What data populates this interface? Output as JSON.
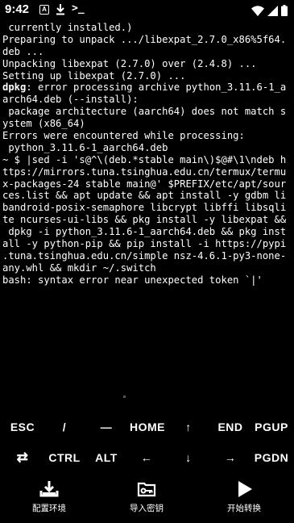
{
  "status_bar": {
    "time": "9:42",
    "notification_a": "A",
    "terminal_glyph": ">_"
  },
  "terminal": {
    "lines": [
      " currently installed.)",
      "Preparing to unpack .../libexpat_2.7.0_x86%5f64.",
      "deb ...",
      "Unpacking libexpat (2.7.0) over (2.4.8) ...",
      "Setting up libexpat (2.7.0) ...",
      "__DPKG__: error processing archive python_3.11.6-1_a",
      "arch64.deb (--install):",
      " package architecture (aarch64) does not match s",
      "ystem (x86_64)",
      "Errors were encountered while processing:",
      " python_3.11.6-1_aarch64.deb",
      "~ $ |sed -i 's@^\\(deb.*stable main\\)$@#\\1\\ndeb h",
      "ttps://mirrors.tuna.tsinghua.edu.cn/termux/termu",
      "x-packages-24 stable main@' $PREFIX/etc/apt/sour",
      "ces.list && apt update && apt install -y gdbm li",
      "bandroid-posix-semaphore libcrypt libffi libsqli",
      "te ncurses-ui-libs && pkg install -y libexpat &&",
      " dpkg -i python_3.11.6-1_aarch64.deb && pkg inst",
      "all -y python-pip && pip install -i https://pypi",
      ".tuna.tsinghua.edu.cn/simple nsz-4.6.1-py3-none-",
      "any.whl && mkdir ~/.switch",
      "bash: syntax error near unexpected token `|'"
    ],
    "dpkg_word": "dpkg"
  },
  "extra_keys": {
    "row1": [
      "ESC",
      "/",
      "—",
      "HOME",
      "↑",
      "END",
      "PGUP"
    ],
    "row2": [
      "⇄",
      "CTRL",
      "ALT",
      "←",
      "↓",
      "→",
      "PGDN"
    ]
  },
  "bottom_nav": {
    "config_env": "配置环境",
    "import_key": "导入密钥",
    "start_convert": "开始转换"
  }
}
